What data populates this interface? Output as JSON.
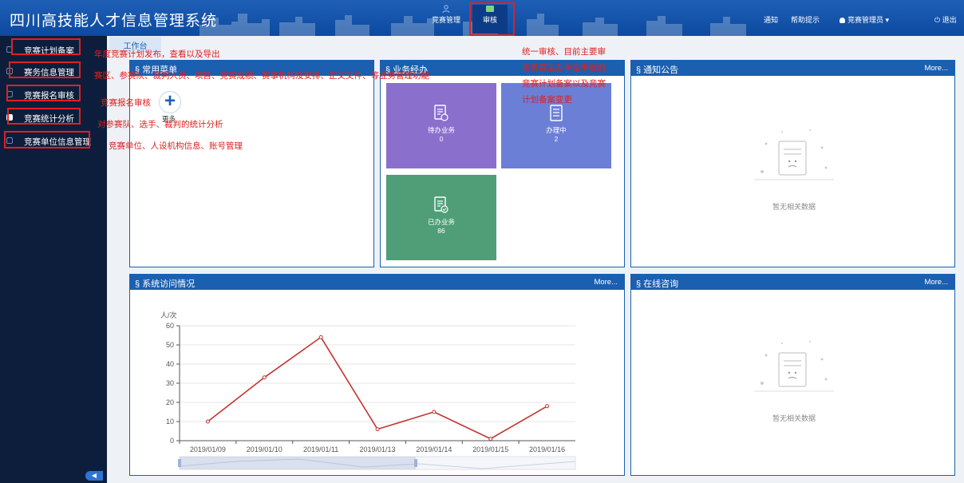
{
  "app_title": "四川高技能人才信息管理系统",
  "top_nav": [
    {
      "label": "竞赛管理",
      "icon": "person-icon"
    },
    {
      "label": "审核",
      "icon": "card-icon"
    }
  ],
  "top_right": {
    "notice": "通知",
    "help": "帮助提示",
    "user": "竞赛管理员",
    "logout": "退出"
  },
  "sidebar": [
    {
      "label": "竞赛计划备案"
    },
    {
      "label": "赛务信息管理"
    },
    {
      "label": "竞赛报名审核"
    },
    {
      "label": "竞赛统计分析"
    },
    {
      "label": "竞赛单位信息管理"
    }
  ],
  "tab": "工作台",
  "panels": {
    "common_menu": {
      "title": "§ 常用菜单",
      "more_label": "更多"
    },
    "business": {
      "title": "§ 业务经办",
      "tiles": [
        {
          "label": "待办业务",
          "count": "0",
          "color": "#8a6fcc"
        },
        {
          "label": "办理中",
          "count": "2",
          "color": "#6b7fd6"
        },
        {
          "label": "已办业务",
          "count": "86",
          "color": "#4f9e78"
        }
      ]
    },
    "notice": {
      "title": "§ 通知公告",
      "more": "More...",
      "empty": "暂无相关数据"
    },
    "visits": {
      "title": "§ 系统访问情况",
      "more": "More..."
    },
    "consult": {
      "title": "§ 在线咨询",
      "more": "More...",
      "empty": "暂无相关数据"
    }
  },
  "chart_data": {
    "type": "line",
    "ylabel": "人/次",
    "ylim": [
      0,
      60
    ],
    "yticks": [
      "0",
      "10",
      "20",
      "30",
      "40",
      "50",
      "60"
    ],
    "x": [
      "2019/01/09",
      "2019/01/10",
      "2019/01/11",
      "2019/01/13",
      "2019/01/14",
      "2019/01/15",
      "2019/01/16"
    ],
    "series": [
      {
        "values": [
          10,
          33,
          54,
          6,
          15,
          1,
          18
        ],
        "color": "#c23531"
      }
    ]
  },
  "annotations": {
    "plan": "年度竞赛计划发布，查看以及导出",
    "affairs": "赛区、参赛队、裁判人员、项目、竞赛成绩、赛事机构及安排、正文文件、等业务管理功能",
    "signup": "竞赛报名审核",
    "stats": "对参赛队、选手、裁判的统计分析",
    "unit": "竞赛单位、人设机构信息、账号管理",
    "audit1": "统一审核、目前主要审",
    "audit2": "核竞赛主办单位申报的",
    "audit3": "竞赛计划备案以及竞赛",
    "audit4": "计划备案变更"
  }
}
